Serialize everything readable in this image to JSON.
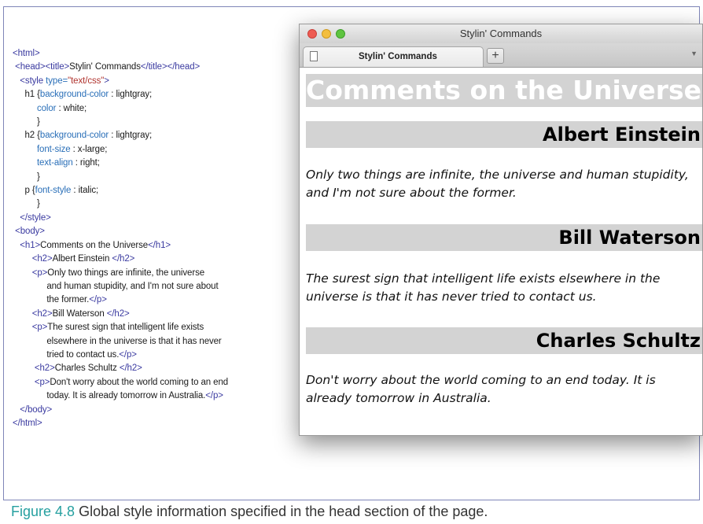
{
  "code_listing": [
    [
      [
        "tag",
        "<html>"
      ]
    ],
    [
      [
        "plain",
        " "
      ],
      [
        "tag",
        "<head><title>"
      ],
      [
        "plain",
        "Stylin' Commands"
      ],
      [
        "tag",
        "</title></head>"
      ]
    ],
    [
      [
        "plain",
        "   "
      ],
      [
        "tag",
        "<style "
      ],
      [
        "prop",
        "type="
      ],
      [
        "str",
        "\"text/css\""
      ],
      [
        "tag",
        ">"
      ]
    ],
    [
      [
        "plain",
        "     h1 {"
      ],
      [
        "prop",
        "background-color"
      ],
      [
        "plain",
        " : lightgray;"
      ]
    ],
    [
      [
        "plain",
        "          "
      ],
      [
        "prop",
        "color"
      ],
      [
        "plain",
        " : white;"
      ]
    ],
    [
      [
        "plain",
        "          }"
      ]
    ],
    [
      [
        "plain",
        "     h2 {"
      ],
      [
        "prop",
        "background-color"
      ],
      [
        "plain",
        " : lightgray;"
      ]
    ],
    [
      [
        "plain",
        "          "
      ],
      [
        "prop",
        "font-size"
      ],
      [
        "plain",
        " : x-large;"
      ]
    ],
    [
      [
        "plain",
        "          "
      ],
      [
        "prop",
        "text-align"
      ],
      [
        "plain",
        " : right;"
      ]
    ],
    [
      [
        "plain",
        "          }"
      ]
    ],
    [
      [
        "plain",
        "     p {"
      ],
      [
        "prop",
        "font-style"
      ],
      [
        "plain",
        " : italic;"
      ]
    ],
    [
      [
        "plain",
        "          }"
      ]
    ],
    [
      [
        "plain",
        "   "
      ],
      [
        "tag",
        "</style>"
      ]
    ],
    [
      [
        "plain",
        " "
      ],
      [
        "tag",
        "<body>"
      ]
    ],
    [
      [
        "plain",
        "   "
      ],
      [
        "tag",
        "<h1>"
      ],
      [
        "plain",
        "Comments on the Universe"
      ],
      [
        "tag",
        "</h1>"
      ]
    ],
    [
      [
        "plain",
        "        "
      ],
      [
        "tag",
        "<h2>"
      ],
      [
        "plain",
        "Albert Einstein "
      ],
      [
        "tag",
        "</h2>"
      ]
    ],
    [
      [
        "plain",
        "        "
      ],
      [
        "tag",
        "<p>"
      ],
      [
        "plain",
        "Only two things are infinite, the universe"
      ]
    ],
    [
      [
        "plain",
        "              and human stupidity, and I'm not sure about"
      ]
    ],
    [
      [
        "plain",
        "              the former."
      ],
      [
        "tag",
        "</p>"
      ]
    ],
    [
      [
        "plain",
        "        "
      ],
      [
        "tag",
        "<h2>"
      ],
      [
        "plain",
        "Bill Waterson "
      ],
      [
        "tag",
        "</h2>"
      ]
    ],
    [
      [
        "plain",
        "        "
      ],
      [
        "tag",
        "<p>"
      ],
      [
        "plain",
        "The surest sign that intelligent life exists"
      ]
    ],
    [
      [
        "plain",
        "              elsewhere in the universe is that it has never"
      ]
    ],
    [
      [
        "plain",
        "              tried to contact us."
      ],
      [
        "tag",
        "</p>"
      ]
    ],
    [
      [
        "plain",
        "         "
      ],
      [
        "tag",
        "<h2>"
      ],
      [
        "plain",
        "Charles Schultz "
      ],
      [
        "tag",
        "</h2>"
      ]
    ],
    [
      [
        "plain",
        "         "
      ],
      [
        "tag",
        "<p>"
      ],
      [
        "plain",
        "Don't worry about the world coming to an end"
      ]
    ],
    [
      [
        "plain",
        "              today. It is already tomorrow in Australia."
      ],
      [
        "tag",
        "</p>"
      ]
    ],
    [
      [
        "plain",
        "   "
      ],
      [
        "tag",
        "</body>"
      ]
    ],
    [
      [
        "tag",
        "</html>"
      ]
    ]
  ],
  "colors": {
    "tag": "#3a3aa0",
    "property": "#2a6fb8",
    "string": "#b0332e",
    "heading_bg": "#d3d3d3",
    "caption_figure": "#26a0a0"
  },
  "browser": {
    "window_title": "Stylin' Commands",
    "tab_label": "Stylin' Commands",
    "new_tab_label": "+",
    "tab_menu_icon": "chevron-down-icon"
  },
  "rendered_page": {
    "h1": "Comments on the Universe",
    "sections": [
      {
        "heading": "Albert Einstein",
        "paragraph": "Only two things are infinite, the universe and human stupidity, and I'm not sure about the former."
      },
      {
        "heading": "Bill Waterson",
        "paragraph": "The surest sign that intelligent life exists elsewhere in the universe is that it has never tried to contact us."
      },
      {
        "heading": "Charles Schultz",
        "paragraph": "Don't worry about the world coming to an end today. It is already tomorrow in Australia."
      }
    ]
  },
  "caption": {
    "figure_label": "Figure 4.8",
    "text": "Global style information specified in the head section of the page."
  }
}
